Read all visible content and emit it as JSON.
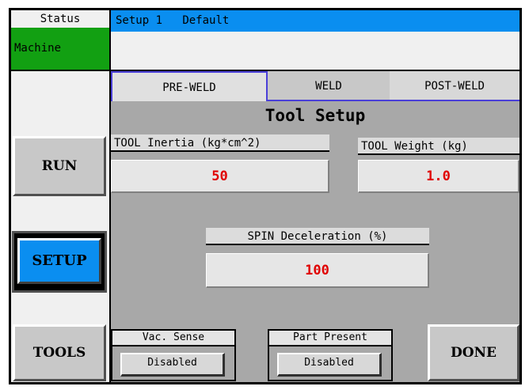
{
  "status": {
    "label": "Status",
    "value": "Machine"
  },
  "header": {
    "setup_name": "Setup 1",
    "profile": "Default"
  },
  "nav": {
    "run": "RUN",
    "setup": "SETUP",
    "tools": "TOOLS"
  },
  "tabs": [
    {
      "label": "PRE-WELD",
      "active": true
    },
    {
      "label": "WELD",
      "active": false
    },
    {
      "label": "POST-WELD",
      "active": false
    }
  ],
  "panel": {
    "title": "Tool Setup",
    "fields": {
      "inertia": {
        "label": "TOOL Inertia (kg*cm^2)",
        "value": "50"
      },
      "weight": {
        "label": "TOOL Weight (kg)",
        "value": "1.0"
      },
      "spin_decel": {
        "label": "SPIN Deceleration (%)",
        "value": "100"
      }
    }
  },
  "footer": {
    "vac_sense": {
      "label": "Vac. Sense",
      "value": "Disabled"
    },
    "part_present": {
      "label": "Part Present",
      "value": "Disabled"
    },
    "done": "DONE"
  },
  "colors": {
    "accent_blue": "#0a8ef0",
    "status_green": "#12a012",
    "value_red": "#e00000",
    "tab_border": "#4a3fd8"
  }
}
